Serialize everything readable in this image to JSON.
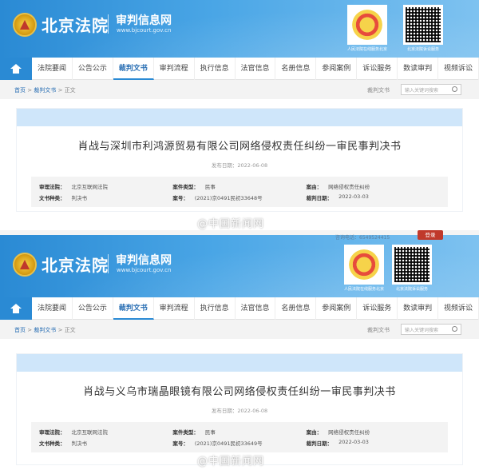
{
  "header": {
    "court_name": "北京法院",
    "site_name": "审判信息网",
    "site_url": "www.bjcourt.gov.cn",
    "qr_captions": [
      "人民法院在线服务北京",
      "北京法院诉讼服务"
    ]
  },
  "nav": {
    "items": [
      "法院要闻",
      "公告公示",
      "裁判文书",
      "审判流程",
      "执行信息",
      "法官信息",
      "名册信息",
      "参阅案例",
      "诉讼服务",
      "数读审判",
      "视频诉讼"
    ],
    "active": "裁判文书"
  },
  "breadcrumb": {
    "home": "首页",
    "sep": ">",
    "section": "裁判文书",
    "current": "正文"
  },
  "search": {
    "label": "裁判文书",
    "placeholder": "输入关键词搜索"
  },
  "documents": [
    {
      "title": "肖战与深圳市利鸿源贸易有限公司网络侵权责任纠纷一审民事判决书",
      "publish_label": "发布日期：",
      "publish_date": "2022-06-08",
      "court_label": "审理法院：",
      "court": "北京互联网法院",
      "case_type_label": "案件类型：",
      "case_type": "民事",
      "cause_label": "案由：",
      "cause": "网络侵权责任纠纷",
      "doc_type_label": "文书种类：",
      "doc_type": "判决书",
      "case_no_label": "案号：",
      "case_no": "(2021)京0491民初33648号",
      "judge_date_label": "裁判日期：",
      "judge_date": "2022-03-03"
    },
    {
      "title": "肖战与义乌市瑞晶眼镜有限公司网络侵权责任纠纷一审民事判决书",
      "publish_label": "发布日期：",
      "publish_date": "2022-06-08",
      "court_label": "审理法院：",
      "court": "北京互联网法院",
      "case_type_label": "案件类型：",
      "case_type": "民事",
      "cause_label": "案由：",
      "cause": "网络侵权责任纠纷",
      "doc_type_label": "文书种类：",
      "doc_type": "判决书",
      "case_no_label": "案号：",
      "case_no": "(2021)京0491民初33649号",
      "judge_date_label": "裁判日期：",
      "judge_date": "2022-03-03"
    }
  ],
  "watermark": "@中国新闻网",
  "topbar": {
    "phone": "咨询电话：65495244​15",
    "login": "登录"
  }
}
